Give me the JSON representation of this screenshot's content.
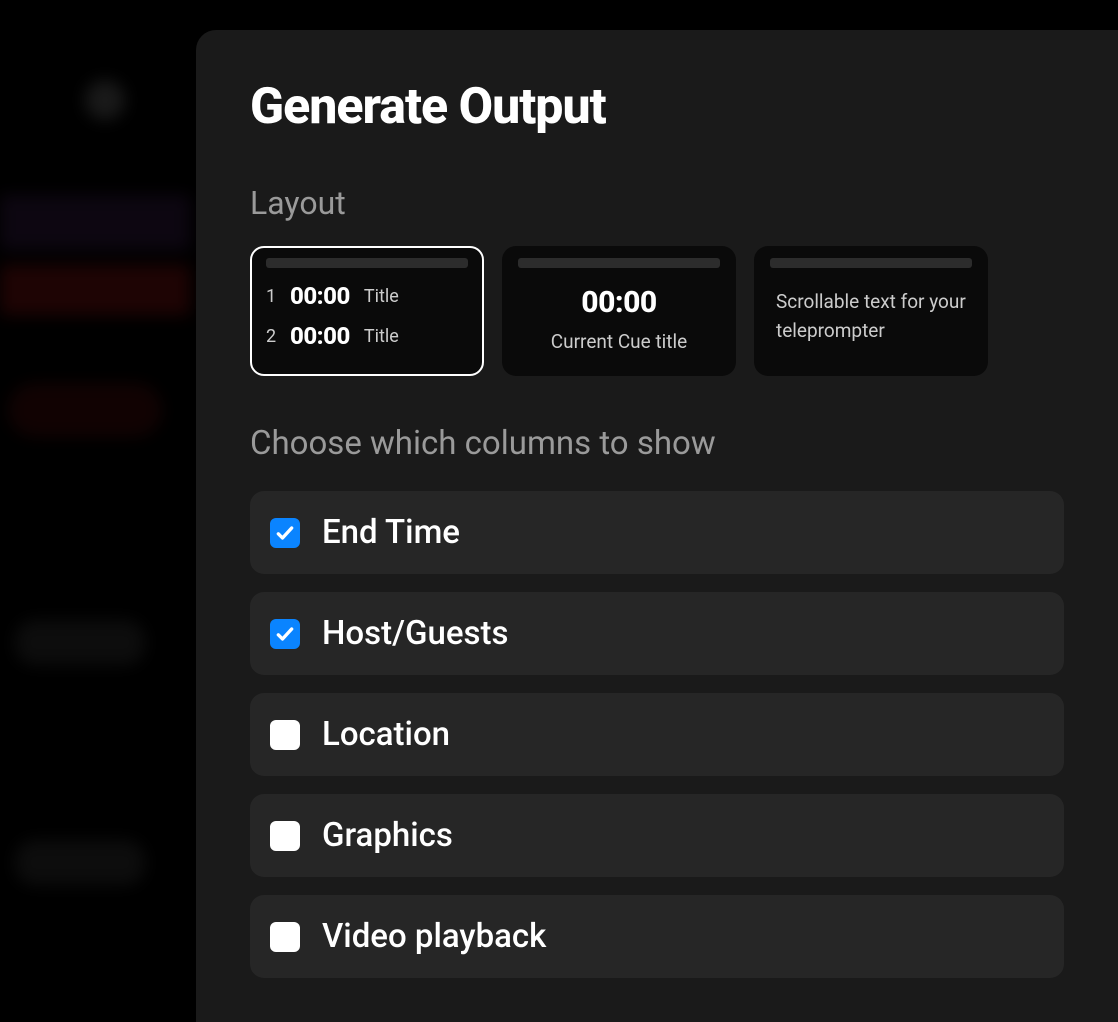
{
  "modal": {
    "title": "Generate Output",
    "layout_section_label": "Layout",
    "columns_section_label": "Choose which columns to show"
  },
  "layouts": [
    {
      "selected": true,
      "rows": [
        {
          "num": "1",
          "time": "00:00",
          "title": "Title"
        },
        {
          "num": "2",
          "time": "00:00",
          "title": "Title"
        }
      ]
    },
    {
      "selected": false,
      "big_time": "00:00",
      "subtitle": "Current Cue title"
    },
    {
      "selected": false,
      "desc": "Scrollable text for your teleprompter"
    }
  ],
  "columns": [
    {
      "label": "End Time",
      "checked": true
    },
    {
      "label": "Host/Guests",
      "checked": true
    },
    {
      "label": "Location",
      "checked": false
    },
    {
      "label": "Graphics",
      "checked": false
    },
    {
      "label": "Video playback",
      "checked": false
    }
  ]
}
